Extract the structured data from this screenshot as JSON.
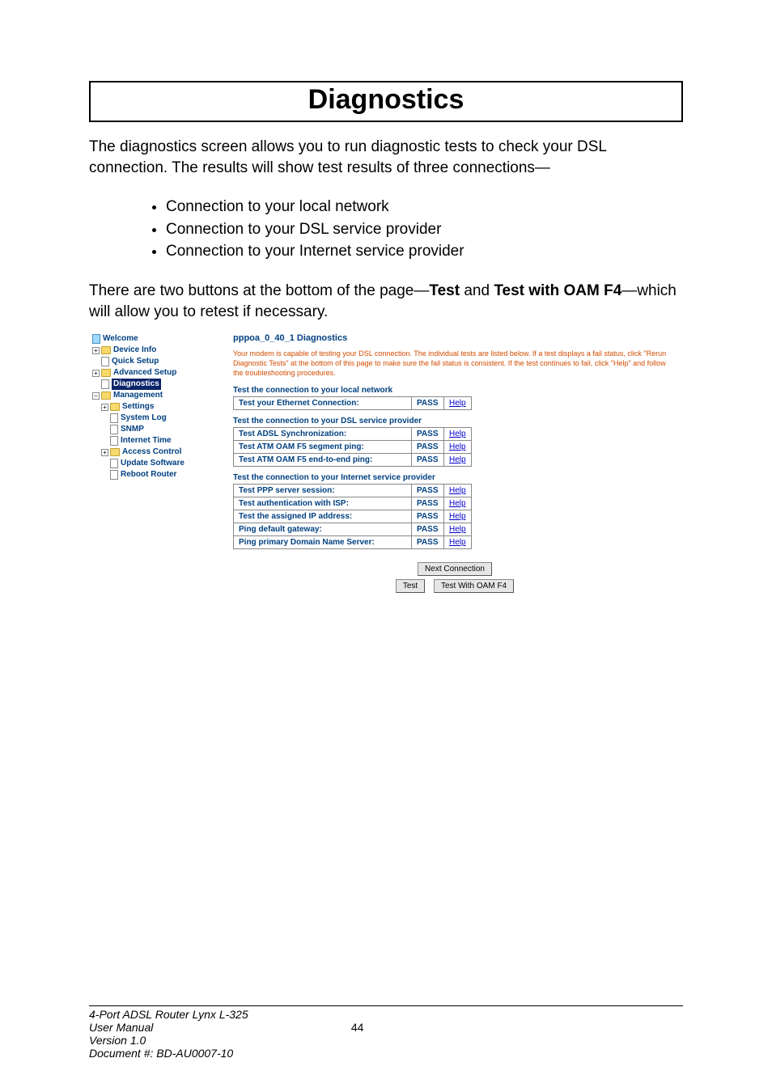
{
  "page": {
    "title": "Diagnostics",
    "intro": "The diagnostics screen allows you to run diagnostic tests to check your DSL connection.  The results will show test results of three connections—",
    "bullets": [
      "Connection to your local network",
      "Connection to your DSL service provider",
      "Connection to your Internet service provider"
    ],
    "pre_screenshot_1a": "There are two buttons at the bottom of the page—",
    "pre_screenshot_1b": "Test",
    "pre_screenshot_1c": " and ",
    "pre_screenshot_1d": "Test with OAM F4",
    "pre_screenshot_1e": "—which will allow you to retest if necessary."
  },
  "tree": {
    "expander_plus": "+",
    "expander_minus": "−",
    "items": [
      {
        "label": "Welcome",
        "iconClass": "page-icon highlight",
        "indent": "indent1",
        "expander": ""
      },
      {
        "label": "Device Info",
        "iconClass": "folder-closed",
        "indent": "indent1",
        "expander": "+"
      },
      {
        "label": "Quick Setup",
        "iconClass": "page-icon",
        "indent": "indent2",
        "expander": ""
      },
      {
        "label": "Advanced Setup",
        "iconClass": "folder-closed",
        "indent": "indent1",
        "expander": "+"
      },
      {
        "label": "Diagnostics",
        "iconClass": "page-icon",
        "indent": "indent2",
        "expander": "",
        "selected": true
      },
      {
        "label": "Management",
        "iconClass": "folder-open",
        "indent": "indent1",
        "expander": "−"
      },
      {
        "label": "Settings",
        "iconClass": "folder-closed",
        "indent": "indent2",
        "expander": "+"
      },
      {
        "label": "System Log",
        "iconClass": "page-icon",
        "indent": "indent3",
        "expander": ""
      },
      {
        "label": "SNMP",
        "iconClass": "page-icon",
        "indent": "indent3",
        "expander": ""
      },
      {
        "label": "Internet Time",
        "iconClass": "page-icon",
        "indent": "indent3",
        "expander": ""
      },
      {
        "label": "Access Control",
        "iconClass": "folder-closed",
        "indent": "indent2",
        "expander": "+"
      },
      {
        "label": "Update Software",
        "iconClass": "page-icon",
        "indent": "indent3",
        "expander": ""
      },
      {
        "label": "Reboot Router",
        "iconClass": "page-icon",
        "indent": "indent3",
        "expander": ""
      }
    ]
  },
  "diag": {
    "title": "pppoa_0_40_1 Diagnostics",
    "desc": "Your modem is capable of testing your DSL connection. The individual tests are listed below. If a test displays a fail status, click \"Rerun Diagnostic Tests\" at the bottom of this page to make sure the fail status is consistent. If the test continues to fail, click \"Help\" and follow the troubleshooting procedures.",
    "help_label": "Help",
    "sections": [
      {
        "head": "Test the connection to your local network",
        "rows": [
          {
            "name": "Test your Ethernet Connection:",
            "status": "PASS"
          }
        ]
      },
      {
        "head": "Test the connection to your DSL service provider",
        "rows": [
          {
            "name": "Test ADSL Synchronization:",
            "status": "PASS"
          },
          {
            "name": "Test ATM OAM F5 segment ping:",
            "status": "PASS"
          },
          {
            "name": "Test ATM OAM F5 end-to-end ping:",
            "status": "PASS"
          }
        ]
      },
      {
        "head": "Test the connection to your Internet service provider",
        "rows": [
          {
            "name": "Test PPP server session:",
            "status": "PASS"
          },
          {
            "name": "Test authentication with ISP:",
            "status": "PASS"
          },
          {
            "name": "Test the assigned IP address:",
            "status": "PASS"
          },
          {
            "name": "Ping default gateway:",
            "status": "PASS"
          },
          {
            "name": "Ping primary Domain Name Server:",
            "status": "PASS"
          }
        ]
      }
    ],
    "buttons": {
      "next": "Next Connection",
      "test": "Test",
      "test_oam": "Test With OAM F4"
    }
  },
  "footer": {
    "product": "4-Port ADSL Router Lynx L-325",
    "manual": "User Manual",
    "page_no": "44",
    "version": "Version 1.0",
    "doc": "Document #:  BD-AU0007-10"
  }
}
